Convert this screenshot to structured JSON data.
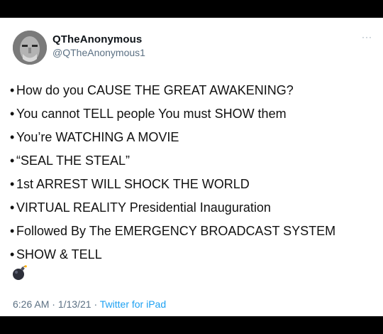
{
  "tweet": {
    "display_name": "QTheAnonymous",
    "handle": "@QTheAnonymous1",
    "more_icon": "···",
    "bullet": "•",
    "lines": [
      "How do you CAUSE THE GREAT AWAKENING?",
      "You cannot TELL people You must SHOW them",
      "You’re WATCHING A MOVIE",
      "“SEAL THE STEAL”",
      "1st ARREST WILL SHOCK THE WORLD",
      "VIRTUAL REALITY Presidential Inauguration",
      "Followed By The EMERGENCY BROADCAST SYSTEM",
      "SHOW & TELL"
    ],
    "emoji_icon": "bomb-emoji",
    "time": "6:26 AM",
    "date": "1/13/21",
    "separator": "·",
    "source": "Twitter for iPad"
  },
  "colors": {
    "background": "#000000",
    "card": "#ffffff",
    "secondary_text": "#5b7083",
    "link": "#1da1f2"
  }
}
